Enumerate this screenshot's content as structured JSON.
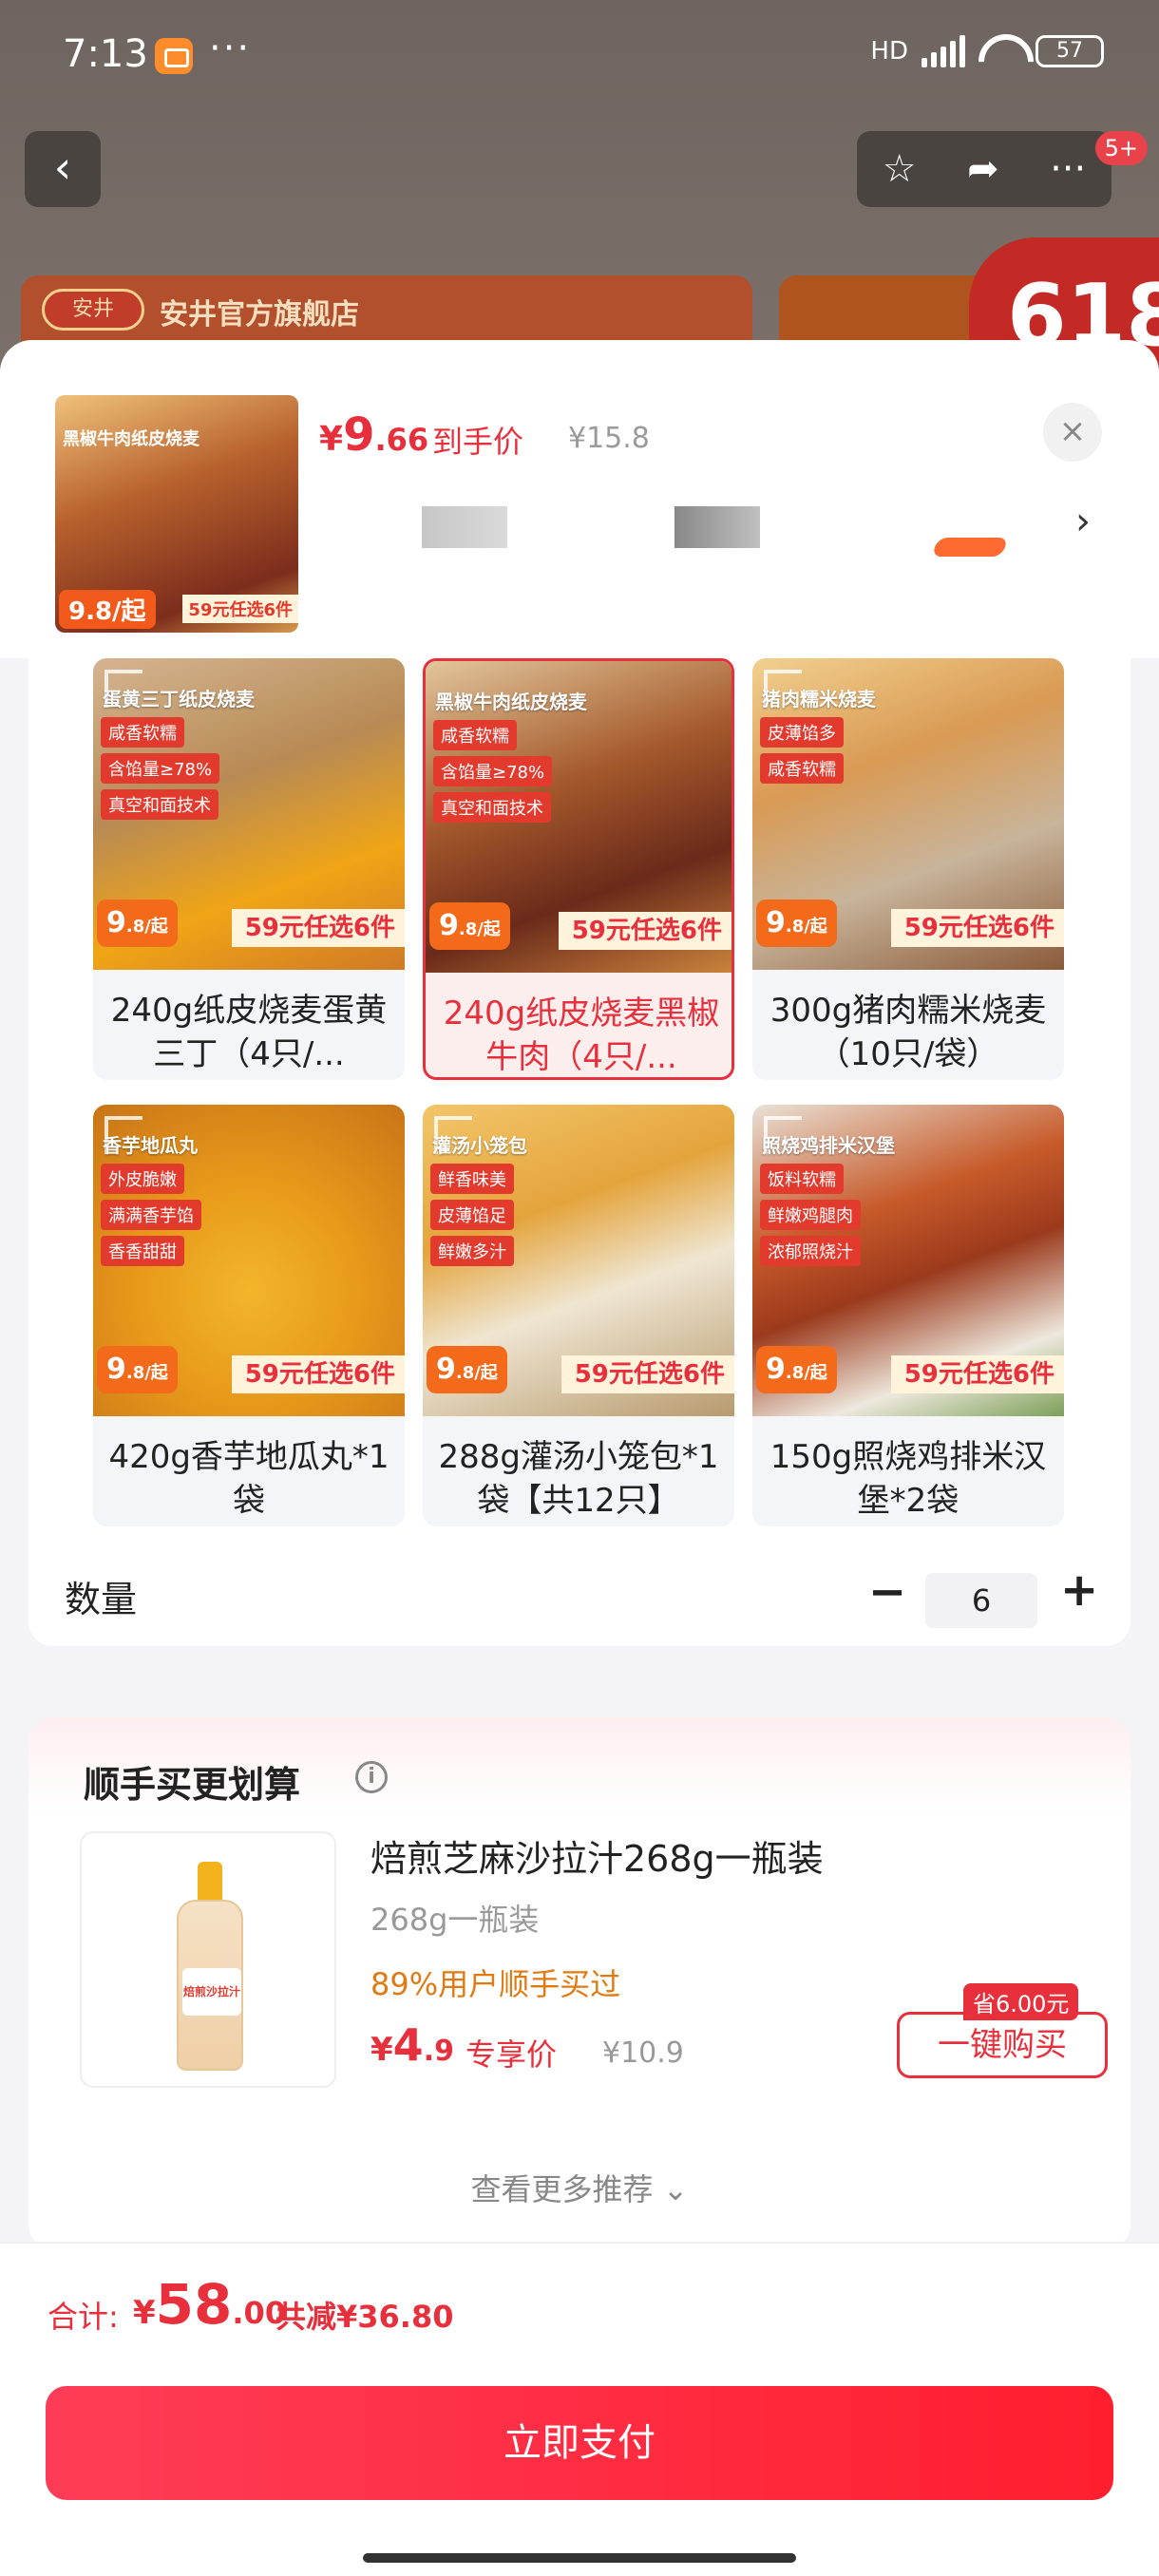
{
  "status_bar": {
    "time": "7:13",
    "dots": "···",
    "network": "HD",
    "battery": "57"
  },
  "nav": {
    "back_icon": "‹",
    "star_icon": "☆",
    "share_icon": "➦",
    "more_icon": "···",
    "badge": "5+"
  },
  "store": {
    "logo": "安井",
    "name": "安井官方旗舰店",
    "promo": "618"
  },
  "sheet": {
    "price_symbol": "¥",
    "price_int": "9",
    "price_dec": ".66",
    "price_tag": "到手价",
    "price_original": "¥15.8",
    "close_icon": "×",
    "next_icon": "›"
  },
  "thumb": {
    "name": "黑椒牛肉纸皮烧麦",
    "tags": "咸香软糯 含馅量≥78% 真空和面技术",
    "price": "9.8/起",
    "deal": "59元任选6件"
  },
  "products": [
    {
      "name": "240g纸皮烧麦蛋黄三丁（4只/...",
      "banner": "蛋黄三丁纸皮烧麦",
      "tags": [
        "咸香软糯",
        "含馅量≥78%",
        "真空和面技术"
      ],
      "price": "9",
      "price_unit": ".8/起",
      "deal": "59元任选6件",
      "selected": false
    },
    {
      "name": "240g纸皮烧麦黑椒牛肉（4只/...",
      "banner": "黑椒牛肉纸皮烧麦",
      "tags": [
        "咸香软糯",
        "含馅量≥78%",
        "真空和面技术"
      ],
      "price": "9",
      "price_unit": ".8/起",
      "deal": "59元任选6件",
      "selected": true
    },
    {
      "name": "300g猪肉糯米烧麦（10只/袋）",
      "banner": "猪肉糯米烧麦",
      "tags": [
        "皮薄馅多",
        "咸香软糯"
      ],
      "price": "9",
      "price_unit": ".8/起",
      "deal": "59元任选6件",
      "selected": false
    },
    {
      "name": "420g香芋地瓜丸*1袋",
      "banner": "香芋地瓜丸",
      "tags": [
        "外皮脆嫩",
        "满满香芋馅",
        "香香甜甜"
      ],
      "price": "9",
      "price_unit": ".8/起",
      "deal": "59元任选6件",
      "selected": false
    },
    {
      "name": "288g灌汤小笼包*1袋【共12只】",
      "banner": "灌汤小笼包",
      "tags": [
        "鲜香味美",
        "皮薄馅足",
        "鲜嫩多汁"
      ],
      "price": "9",
      "price_unit": ".8/起",
      "deal": "59元任选6件",
      "selected": false
    },
    {
      "name": "150g照烧鸡排米汉堡*2袋",
      "banner": "照烧鸡排米汉堡",
      "tags": [
        "饭料软糯",
        "鲜嫩鸡腿肉",
        "浓郁照烧汁"
      ],
      "price": "9",
      "price_unit": ".8/起",
      "deal": "59元任选6件",
      "selected": false
    }
  ],
  "quantity": {
    "label": "数量",
    "minus": "−",
    "value": "6",
    "plus": "+"
  },
  "recommend": {
    "title": "顺手买更划算",
    "info_icon": "i",
    "product_name": "焙煎芝麻沙拉汁268g一瓶装",
    "spec": "268g一瓶装",
    "bought": "89%用户顺手买过",
    "price_symbol": "¥",
    "price_int": "4",
    "price_dec": ".9",
    "price_tag": "专享价",
    "price_original": "¥10.9",
    "save_badge": "省6.00元",
    "buy_button": "一键购买",
    "see_more": "查看更多推荐 ⌄",
    "bottle_label": "焙煎沙拉汁"
  },
  "footer": {
    "total_label": "合计:",
    "total_symbol": "¥",
    "total_int": "58",
    "total_dec": ".00",
    "saved": "共减¥36.80",
    "pay_button": "立即支付"
  },
  "colors": {
    "accent": "#e8303c",
    "price_orange": "#f36a1b",
    "pay_gradient_start": "#ff3c57",
    "pay_gradient_end": "#ff1e2e"
  }
}
